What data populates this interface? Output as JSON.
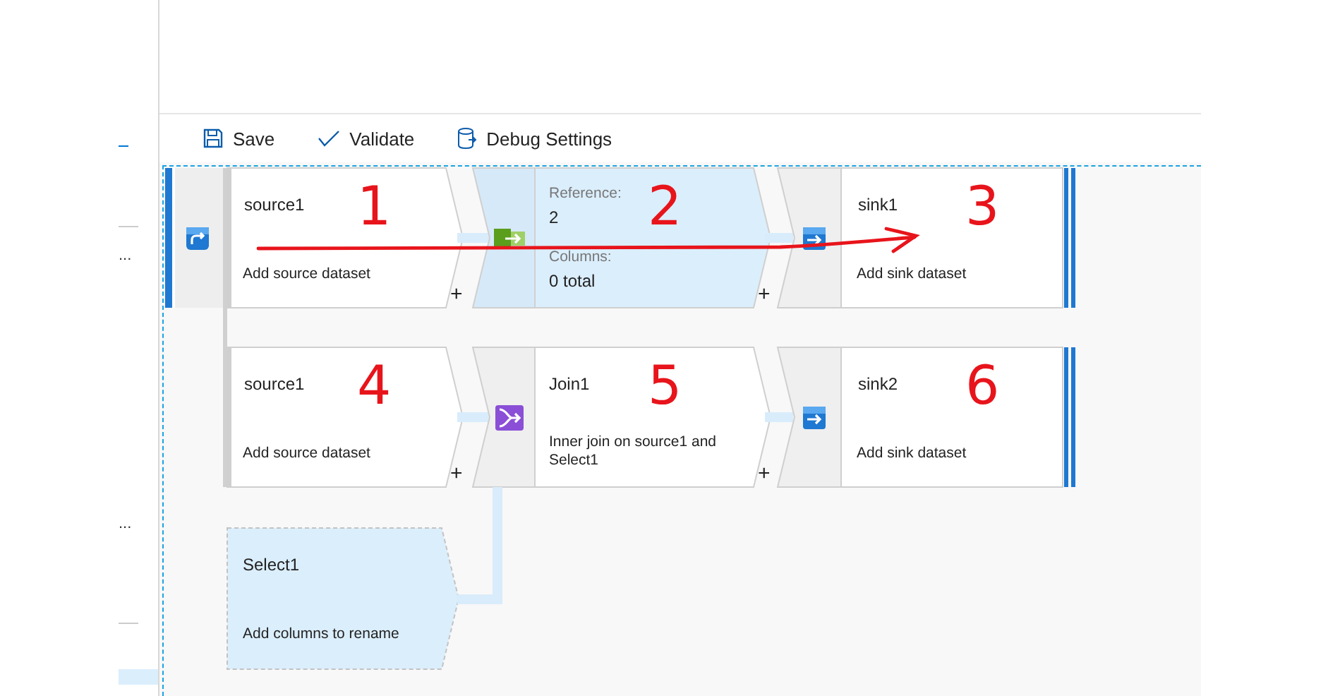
{
  "sidebar": {
    "overflow_marks": [
      "...",
      "..."
    ]
  },
  "toolbar": [
    {
      "kind": "save",
      "label": "Save"
    },
    {
      "kind": "validate",
      "label": "Validate"
    },
    {
      "kind": "debug",
      "label": "Debug Settings"
    }
  ],
  "flows": [
    {
      "selected": true,
      "nodes": [
        {
          "kind": "source",
          "title": "source1",
          "subtitle": "Add source dataset",
          "add": "+",
          "annotation": "1"
        },
        {
          "kind": "derived",
          "selected": true,
          "fields": [
            {
              "label": "Reference:",
              "value": "2"
            },
            {
              "label": "Columns:",
              "value": "0 total"
            }
          ],
          "add": "+",
          "annotation": "2"
        },
        {
          "kind": "sink",
          "title": "sink1",
          "subtitle": "Add sink dataset",
          "annotation": "3"
        }
      ]
    },
    {
      "selected": false,
      "nodes": [
        {
          "kind": "source",
          "title": "source1",
          "subtitle": "Add source dataset",
          "add": "+",
          "annotation": "4"
        },
        {
          "kind": "join",
          "selected": false,
          "title": "Join1",
          "subtitle": "Inner join on source1 and Select1",
          "add": "+",
          "annotation": "5"
        },
        {
          "kind": "sink",
          "title": "sink2",
          "subtitle": "Add sink dataset",
          "annotation": "6"
        }
      ]
    }
  ],
  "branch": {
    "kind": "select",
    "title": "Select1",
    "subtitle": "Add columns to rename"
  }
}
